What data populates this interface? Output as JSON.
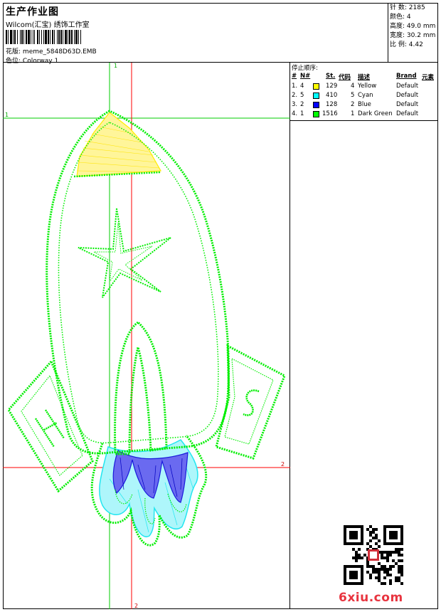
{
  "header": {
    "title": "生产作业图",
    "studio": "Wilcom(汇宝) 绣饰工作室",
    "file_label": "花版:",
    "file_name": "meme_5848D63D.EMB",
    "colorway_label": "色位:",
    "colorway_name": "Colorway 1"
  },
  "stats": [
    {
      "label": "针 数:",
      "value": "2185"
    },
    {
      "label": "颜色:",
      "value": "4"
    },
    {
      "label": "高度:",
      "value": "49.0 mm"
    },
    {
      "label": "宽度:",
      "value": "30.2 mm"
    },
    {
      "label": "比 例:",
      "value": "4.42"
    }
  ],
  "stop_sequence": {
    "title": "停止顺序:",
    "headers": {
      "num": "#",
      "n": "N#",
      "st": "St.",
      "code": "代码",
      "desc": "描述",
      "brand": "Brand",
      "elem": "元素"
    },
    "rows": [
      {
        "num": "1.",
        "n": "4",
        "color": "#ffff00",
        "st": "129",
        "code": "4",
        "desc": "Yellow",
        "brand": "Default"
      },
      {
        "num": "2.",
        "n": "5",
        "color": "#00ffff",
        "st": "410",
        "code": "5",
        "desc": "Cyan",
        "brand": "Default"
      },
      {
        "num": "3.",
        "n": "2",
        "color": "#0000ff",
        "st": "128",
        "code": "2",
        "desc": "Blue",
        "brand": "Default"
      },
      {
        "num": "4.",
        "n": "1",
        "color": "#00ff00",
        "st": "1516",
        "code": "1",
        "desc": "Dark Green",
        "brand": "Default"
      }
    ]
  },
  "guides": {
    "top_marker": "1",
    "left_marker": "1",
    "right_marker": "2",
    "bottom_marker": "2",
    "guide_green": "#00cc00",
    "guide_red": "#ff0000"
  },
  "thread_colors": {
    "outline": "#00ee00",
    "yellow": "#ffee00",
    "cyan": "#22e6f0",
    "blue": "#1a1adc"
  },
  "watermark": "6xiu.com"
}
